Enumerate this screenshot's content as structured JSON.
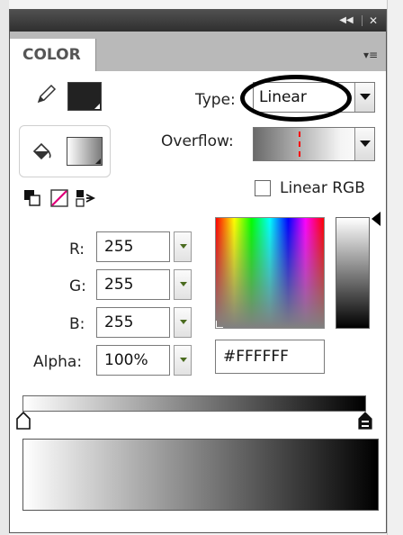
{
  "panel": {
    "tab_label": "COLOR",
    "collapse_label": "◀◀",
    "close_label": "✕",
    "menu_label": "▾≡"
  },
  "stroke": {
    "color": "#222222"
  },
  "fill": {
    "color_top": "#ffffff",
    "color_bottom": "#777777"
  },
  "type": {
    "label": "Type:",
    "value": "Linear"
  },
  "overflow": {
    "label": "Overflow:"
  },
  "linear_rgb": {
    "label": "Linear RGB",
    "checked": false
  },
  "rgb": {
    "r_label": "R:",
    "r_value": "255",
    "g_label": "G:",
    "g_value": "255",
    "b_label": "B:",
    "b_value": "255",
    "alpha_label": "Alpha:",
    "alpha_value": "100%"
  },
  "hex": {
    "value": "#FFFFFF"
  },
  "colors": {
    "accent_green": "#4a6b1f",
    "annotation_ring": "#000000",
    "overflow_marker": "#ff0000"
  }
}
